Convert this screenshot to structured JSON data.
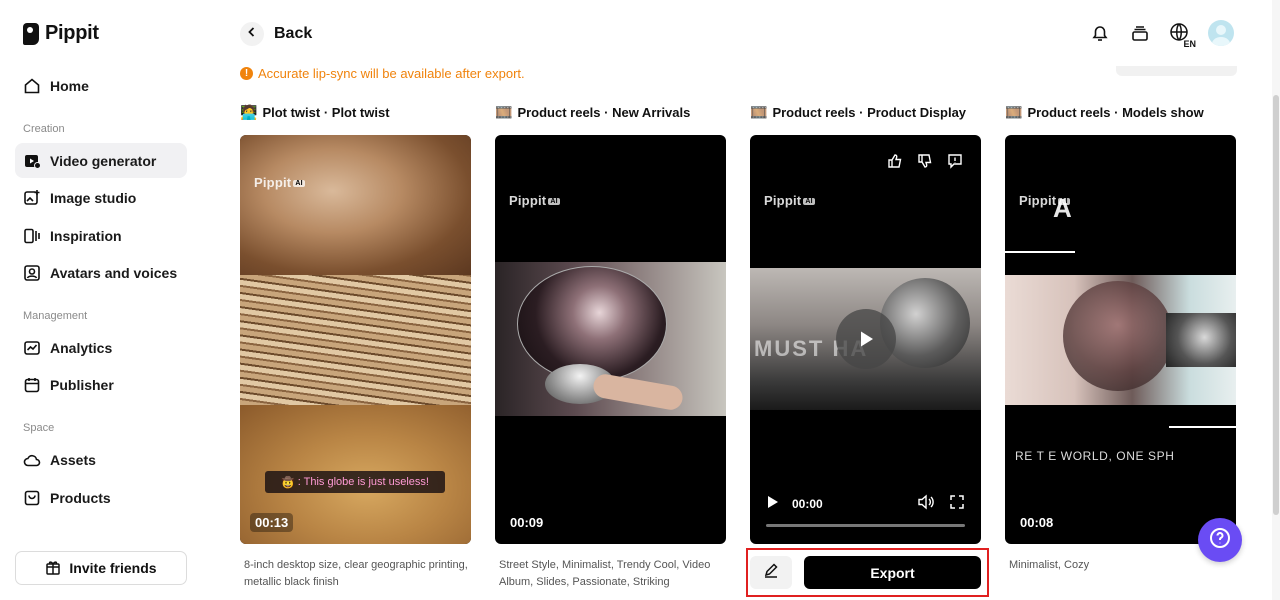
{
  "app": {
    "logo_text": "Pippit"
  },
  "sidebar": {
    "home": "Home",
    "section_creation": "Creation",
    "creation_items": [
      {
        "label": "Video generator",
        "icon": "video-plus-icon",
        "active": true
      },
      {
        "label": "Image studio",
        "icon": "image-plus-icon"
      },
      {
        "label": "Inspiration",
        "icon": "inspiration-icon"
      },
      {
        "label": "Avatars and voices",
        "icon": "avatar-icon"
      }
    ],
    "section_management": "Management",
    "management_items": [
      {
        "label": "Analytics",
        "icon": "analytics-icon"
      },
      {
        "label": "Publisher",
        "icon": "calendar-icon"
      }
    ],
    "section_space": "Space",
    "space_items": [
      {
        "label": "Assets",
        "icon": "cloud-icon"
      },
      {
        "label": "Products",
        "icon": "bag-icon"
      }
    ],
    "invite_label": "Invite friends"
  },
  "header": {
    "back_label": "Back",
    "lang_code": "EN",
    "notice": "Accurate lip-sync will be available after export."
  },
  "cards": [
    {
      "emoji": "🧑‍💻",
      "title": "Plot twist · Plot twist",
      "duration": "00:13",
      "watermark": "Pippit",
      "watermark_badge": "AI",
      "subtitle_emoji": "🤠",
      "subtitle": ": This globe is just useless!",
      "description": "8-inch desktop size, clear geographic printing, metallic black finish"
    },
    {
      "emoji": "🎞️",
      "title": "Product reels · New Arrivals",
      "duration": "00:09",
      "watermark": "Pippit",
      "watermark_badge": "AI",
      "description": "Street Style, Minimalist, Trendy Cool, Video Album, Slides, Passionate, Striking"
    },
    {
      "emoji": "🎞️",
      "title": "Product reels · Product Display",
      "watermark": "Pippit",
      "watermark_badge": "AI",
      "overlay_text": "MUST HA",
      "player_time": "00:00",
      "progress": 0
    },
    {
      "emoji": "🎞️",
      "title": "Product reels · Models show",
      "duration": "00:08",
      "watermark": "Pippit",
      "watermark_badge": "AI",
      "big_letter": "A",
      "caption": "RE T E WORLD, ONE SPH",
      "description": "Minimalist, Cozy"
    }
  ],
  "actions": {
    "export_label": "Export"
  },
  "colors": {
    "accent": "#6a4cf4",
    "notice": "#f0830c",
    "highlight": "#e02020"
  }
}
